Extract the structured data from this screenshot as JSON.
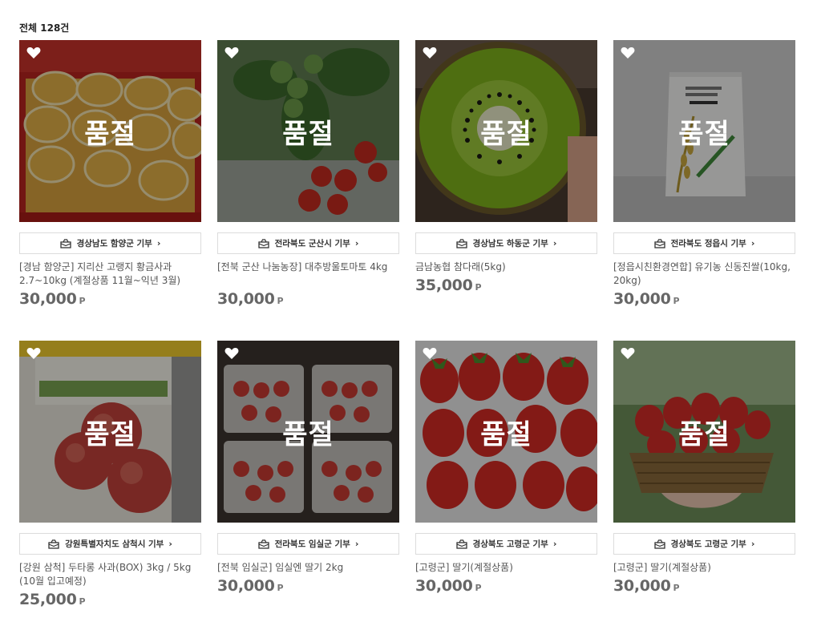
{
  "header": {
    "total_label": "전체 128건"
  },
  "soldout_label": "품절",
  "point_unit": "P",
  "products": [
    {
      "donation": "경상남도 함양군 기부",
      "title": "[경남 함양군] 지리산 고랭지 황금사과 2.7~10kg (계절상품 11월~익년 3월)",
      "price": "30,000",
      "image": "apple-gift-box"
    },
    {
      "donation": "전라북도 군산시 기부",
      "title": "[전북 군산 나눔농장] 대추방울토마토 4kg",
      "price": "30,000",
      "image": "cherry-tomatoes"
    },
    {
      "donation": "경상남도 하동군 기부",
      "title": "금남농협 참다래(5kg)",
      "price": "35,000",
      "image": "kiwi"
    },
    {
      "donation": "전라북도 정읍시 기부",
      "title": "[정읍시친환경연합] 유기농 신동진쌀(10kg, 20kg)",
      "price": "30,000",
      "image": "rice-bag"
    },
    {
      "donation": "강원특별자치도 삼척시 기부",
      "title": "[강원 삼척] 두타롱 사과(BOX) 3kg / 5kg (10월 입고예정)",
      "price": "25,000",
      "image": "apples-box"
    },
    {
      "donation": "전라북도 임실군 기부",
      "title": "[전북 임실군] 임실엔 딸기 2kg",
      "price": "30,000",
      "image": "strawberry-packs"
    },
    {
      "donation": "경상북도 고령군 기부",
      "title": "[고령군] 딸기(계절상품)",
      "price": "30,000",
      "image": "strawberries"
    },
    {
      "donation": "경상북도 고령군 기부",
      "title": "[고령군] 딸기(계절상품)",
      "price": "30,000",
      "image": "strawberry-basket"
    }
  ],
  "colors": {
    "soldout_overlay": "#00000060",
    "price": "#666666",
    "border": "#dcdcdc"
  }
}
